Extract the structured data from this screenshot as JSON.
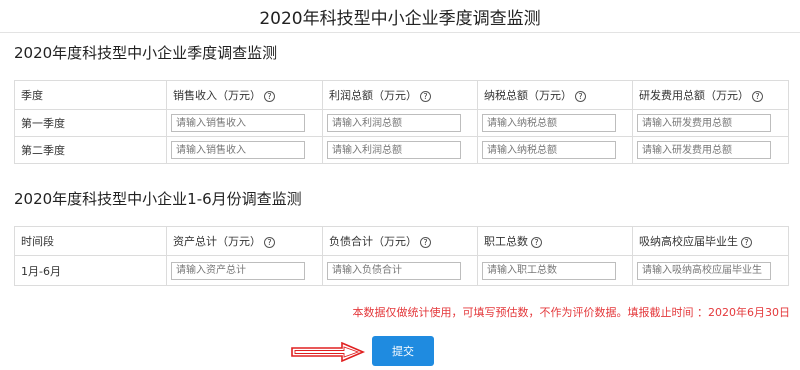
{
  "page_title": "2020年科技型中小企业季度调查监测",
  "section1": {
    "title": "2020年度科技型中小企业季度调查监测",
    "headers": [
      "季度",
      "销售收入（万元）",
      "利润总额（万元）",
      "纳税总额（万元）",
      "研发费用总额（万元）"
    ],
    "rows": [
      {
        "label": "第一季度",
        "placeholders": [
          "请输入销售收入",
          "请输入利润总额",
          "请输入纳税总额",
          "请输入研发费用总额"
        ]
      },
      {
        "label": "第二季度",
        "placeholders": [
          "请输入销售收入",
          "请输入利润总额",
          "请输入纳税总额",
          "请输入研发费用总额"
        ]
      }
    ]
  },
  "section2": {
    "title": "2020年度科技型中小企业1-6月份调查监测",
    "headers": [
      "时间段",
      "资产总计（万元）",
      "负债合计（万元）",
      "职工总数",
      "吸纳高校应届毕业生"
    ],
    "rows": [
      {
        "label": "1月-6月",
        "placeholders": [
          "请输入资产总计",
          "请输入负债合计",
          "请输入职工总数",
          "请输入吸纳高校应届毕业生"
        ]
      }
    ]
  },
  "help_glyph": "?",
  "notice": "本数据仅做统计使用，可填写预估数，不作为评价数据。填报截止时间 ：2020年6月30日",
  "submit_label": "提交",
  "colors": {
    "accent": "#1f8be0",
    "notice": "#e4393c",
    "arrow": "#e02020"
  },
  "icons": {
    "help": "help-circle-icon",
    "arrow": "arrow-right-icon"
  }
}
